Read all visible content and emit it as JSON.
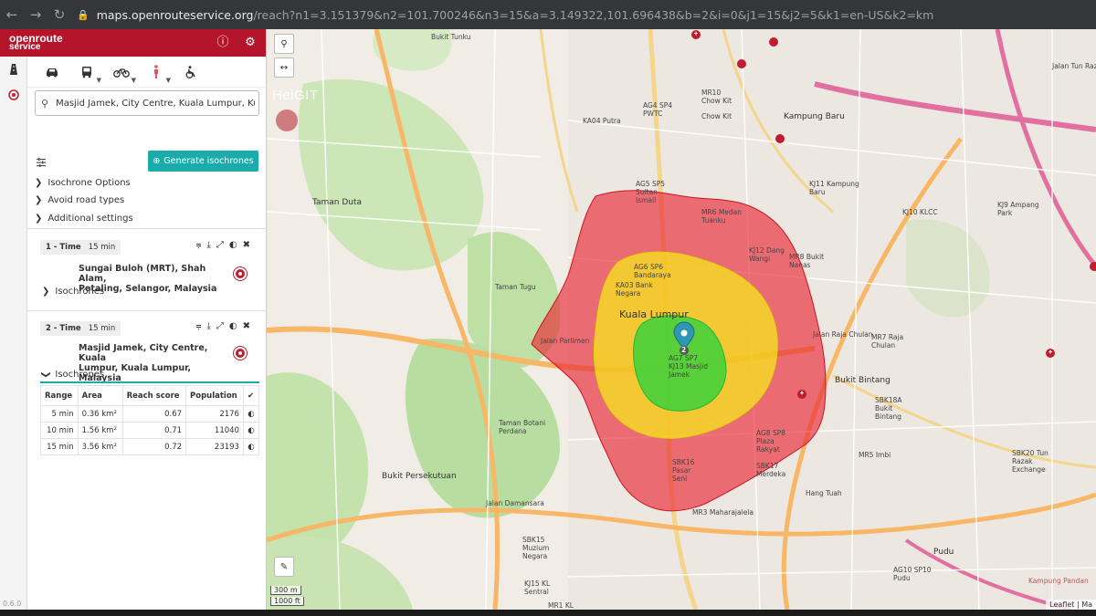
{
  "browser": {
    "url_host": "maps.openrouteservice.org",
    "url_path": "/reach?n1=3.151379&n2=101.700246&n3=15&a=3.149322,101.696438&b=2&i=0&j1=15&j2=5&k1=en-US&k2=km"
  },
  "app": {
    "logo_line1": "openroute",
    "logo_line2": "service",
    "version": "0.6.0"
  },
  "search": {
    "value": "Masjid Jamek, City Centre, Kuala Lumpur, Kuala Lumpur, Malaysia"
  },
  "generate_button": "Generate isochrones",
  "expanders": {
    "isochrone_options": "Isochrone Options",
    "avoid_road_types": "Avoid road types",
    "additional_settings": "Additional settings"
  },
  "isochrones": [
    {
      "tag": "1 - Time",
      "duration": "15 min",
      "location_line1": "Sungai Buloh (MRT), Shah Alam,",
      "location_line2": "Petaling, Selangor, Malaysia",
      "toggle_label": "Isochrones"
    },
    {
      "tag": "2 - Time",
      "duration": "15 min",
      "location_line1": "Masjid Jamek, City Centre, Kuala",
      "location_line2": "Lumpur, Kuala Lumpur, Malaysia",
      "toggle_label": "Isochrones"
    }
  ],
  "table": {
    "headers": [
      "Range",
      "Area",
      "Reach score",
      "Population",
      "✔"
    ],
    "rows": [
      {
        "range": "5 min",
        "area": "0.36 km²",
        "score": "0.67",
        "population": "2176"
      },
      {
        "range": "10 min",
        "area": "1.56 km²",
        "score": "0.71",
        "population": "11040"
      },
      {
        "range": "15 min",
        "area": "3.56 km²",
        "score": "0.72",
        "population": "23193"
      }
    ]
  },
  "map": {
    "brand": "HeiGIT",
    "marker_number": "2",
    "scale_m": "300 m",
    "scale_ft": "1000 ft",
    "attribution": "Leaflet | Ma",
    "labels": {
      "kuala_lumpur": "Kuala Lumpur",
      "taman_duta": "Taman Duta",
      "taman_tugu": "Taman Tugu",
      "taman_botani": "Taman Botani Perdana",
      "bukit_persekutuan": "Bukit Persekutuan",
      "bukit_bintang": "Bukit Bintang",
      "bukit_tunku": "Bukit Tunku",
      "kampung_baru": "Kampung Baru",
      "chow_kit": "Chow Kit",
      "pudu": "Pudu",
      "kj11": "KJ11 Kampung Baru",
      "kj10": "KJ10 KLCC",
      "kj9": "KJ9 Ampang Park",
      "mr8": "MR8 Bukit Nanas",
      "mr7": "MR7 Raja Chulan",
      "mr6": "MR6 Medan Tuanku",
      "kj12": "KJ12 Dang Wangi",
      "ag6": "AG6 SP6 Bandaraya",
      "ka03": "KA03 Bank Negara",
      "ag7": "AG7 SP7 KJ13 Masjid Jamek",
      "ag8": "AG8 SP8 Plaza Rakyat",
      "sbk16": "SBK16 Pasar Seni",
      "sbk17": "SBK17 Merdeka",
      "sbk15": "SBK15 Muzium Negara",
      "kj15": "KJ15 KL Sentral",
      "mr1": "MR1 KL",
      "mr3": "MR3 Maharajalela",
      "mr5": "MR5 Imbi",
      "sbk18a": "SBK18A Bukit Bintang",
      "sbk20": "SBK20 Tun Razak Exchange",
      "ag10": "AG10 SP10 Pudu",
      "hang_tuah": "Hang Tuah",
      "ka04": "KA04 Putra",
      "ag4": "AG4 SP4 PWTC",
      "ag5": "AG5 SP5 Sultan Ismail",
      "mr10": "MR10 Chow Kit",
      "jalan_parlimen": "Jalan Parlimen",
      "jalan_damansara": "Jalan Damansara",
      "jalan_tun_razak": "Jalan Tun Razak",
      "jalan_raja_chulan": "Jalan Raja Chulan",
      "kampung_pandan": "Kampung Pandan"
    }
  },
  "colors": {
    "brand": "#b5152b",
    "teal": "#1aabab",
    "iso15": "#e8212e",
    "iso10": "#f6ec19",
    "iso5": "#2fd23c"
  }
}
